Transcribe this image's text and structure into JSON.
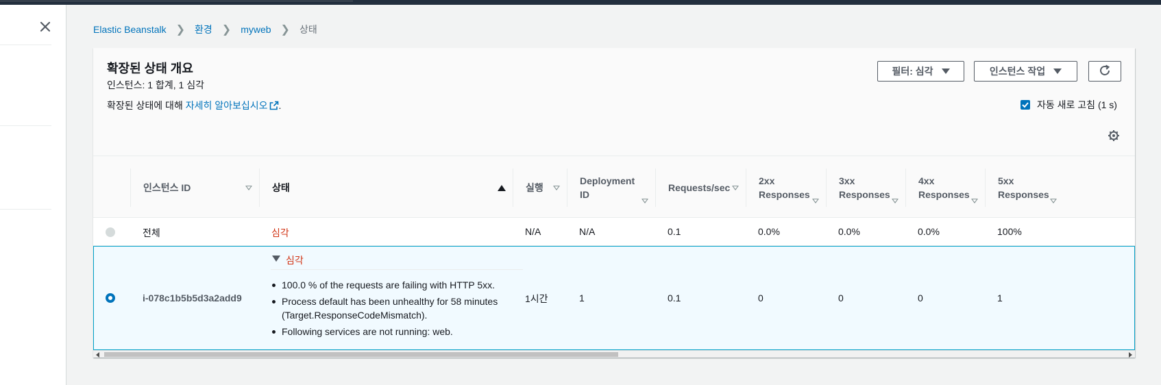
{
  "breadcrumb": [
    {
      "label": "Elastic Beanstalk"
    },
    {
      "label": "환경"
    },
    {
      "label": "myweb"
    },
    {
      "label": "상태"
    }
  ],
  "panel": {
    "title": "확장된 상태 개요",
    "subtitle": "인스턴스: 1 합계, 1 심각",
    "learn_prefix": "확장된 상태에 대해 ",
    "learn_link": "자세히 알아보십시오",
    "learn_suffix": ".",
    "filter_button": "필터: 심각",
    "actions_button": "인스턴스 작업",
    "auto_refresh_label": "자동 새로 고침 (1 s)",
    "auto_refresh_checked": true
  },
  "table": {
    "columns": [
      {
        "label": "인스턴스 ID",
        "line2": ""
      },
      {
        "label": "상태",
        "line2": ""
      },
      {
        "label": "실행",
        "line2": ""
      },
      {
        "label": "Deployment",
        "line2": "ID"
      },
      {
        "label": "Requests/sec",
        "line2": ""
      },
      {
        "label": "2xx",
        "line2": "Responses"
      },
      {
        "label": "3xx",
        "line2": "Responses"
      },
      {
        "label": "4xx",
        "line2": "Responses"
      },
      {
        "label": "5xx",
        "line2": "Responses"
      }
    ],
    "overall": {
      "name": "전체",
      "status": "심각",
      "running": "N/A",
      "deployment_id": "N/A",
      "requests": "0.1",
      "r2xx": "0.0%",
      "r3xx": "0.0%",
      "r4xx": "0.0%",
      "r5xx": "100%"
    },
    "instance": {
      "id": "i-078c1b5b5d3a2add9",
      "status": "심각",
      "causes": [
        "100.0 % of the requests are failing with HTTP 5xx.",
        "Process default has been unhealthy for 58 minutes (Target.ResponseCodeMismatch).",
        "Following services are not running: web."
      ],
      "running": "1시간",
      "deployment_id": "1",
      "requests": "0.1",
      "r2xx": "0",
      "r3xx": "0",
      "r4xx": "0",
      "r5xx": "1"
    }
  },
  "colors": {
    "link": "#0073bb",
    "severe": "#d13212",
    "selected_bg": "#f1faff",
    "selected_border": "#00a1c9"
  },
  "icons": [
    "close-icon",
    "chevron-right-icon",
    "external-link-icon",
    "caret-down-icon",
    "refresh-icon",
    "checkbox-icon",
    "gear-icon",
    "sort-icon",
    "expand-icon",
    "radio-icon"
  ]
}
